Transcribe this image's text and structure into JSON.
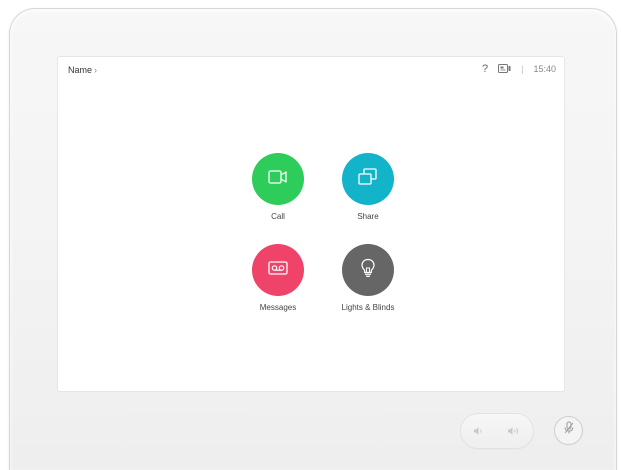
{
  "header": {
    "room_name": "Name",
    "chevron": "›",
    "help_glyph": "?",
    "separator": "|",
    "time": "15:40"
  },
  "tiles": [
    {
      "label": "Call",
      "icon": "video-camera-icon",
      "color": "#2ecc5a"
    },
    {
      "label": "Share",
      "icon": "share-screens-icon",
      "color": "#13b3c9"
    },
    {
      "label": "Messages",
      "icon": "voicemail-icon",
      "color": "#f0436a"
    },
    {
      "label": "Lights & Blinds",
      "icon": "lightbulb-icon",
      "color": "#666666"
    }
  ],
  "hardware": {
    "volume_down_icon": "volume-down-icon",
    "volume_up_icon": "volume-up-icon",
    "mute_icon": "microphone-mute-icon"
  }
}
